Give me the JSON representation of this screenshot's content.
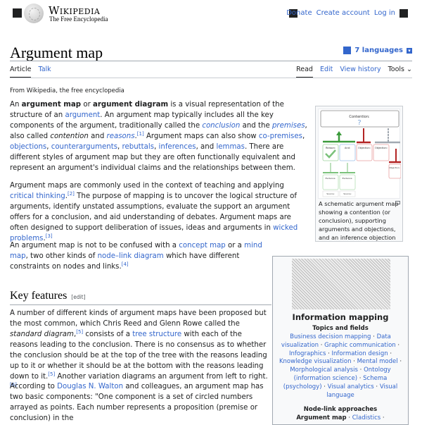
{
  "header": {
    "wordmark": "Wikipedia",
    "tagline": "The Free Encyclopedia",
    "links": [
      "Donate",
      "Create account",
      "Log in"
    ]
  },
  "page": {
    "title": "Argument map",
    "languages_label": "7 languages",
    "tabs_left": [
      "Article",
      "Talk"
    ],
    "tabs_right": [
      "Read",
      "Edit",
      "View history",
      "Tools"
    ],
    "from": "From Wikipedia, the free encyclopedia"
  },
  "intro": {
    "p1": [
      {
        "t": "An "
      },
      {
        "t": "argument map",
        "b": true
      },
      {
        "t": " or "
      },
      {
        "t": "argument diagram",
        "b": true
      },
      {
        "t": " is a visual representation of the structure of an "
      },
      {
        "t": "argument",
        "a": true
      },
      {
        "t": ". An argument map typically includes all the key components of the argument, traditionally called the "
      },
      {
        "t": "conclusion",
        "a": true,
        "i": true
      },
      {
        "t": " and the "
      },
      {
        "t": "premises",
        "a": true,
        "i": true
      },
      {
        "t": ", also called "
      },
      {
        "t": "contention",
        "i": true
      },
      {
        "t": " and "
      },
      {
        "t": "reasons",
        "a": true,
        "i": true
      },
      {
        "t": "."
      },
      {
        "t": "[1]",
        "sup": true
      },
      {
        "t": " Argument maps can also show "
      },
      {
        "t": "co-premises",
        "a": true
      },
      {
        "t": ", "
      },
      {
        "t": "objections",
        "a": true
      },
      {
        "t": ", "
      },
      {
        "t": "counterarguments",
        "a": true
      },
      {
        "t": ", "
      },
      {
        "t": "rebuttals",
        "a": true
      },
      {
        "t": ", "
      },
      {
        "t": "inferences",
        "a": true
      },
      {
        "t": ", and "
      },
      {
        "t": "lemmas",
        "a": true
      },
      {
        "t": ". There are different styles of argument map but they are often functionally equivalent and represent an argument's individual claims and the relationships between them."
      }
    ],
    "p2": [
      {
        "t": "Argument maps are commonly used in the context of teaching and applying "
      },
      {
        "t": "critical thinking",
        "a": true
      },
      {
        "t": "."
      },
      {
        "t": "[2]",
        "sup": true
      },
      {
        "t": " The purpose of mapping is to uncover the logical structure of arguments, identify unstated assumptions, evaluate the support an argument offers for a conclusion, and aid understanding of debates. Argument maps are often designed to support deliberation of issues, ideas and arguments in "
      },
      {
        "t": "wicked problems",
        "a": true
      },
      {
        "t": "."
      },
      {
        "t": "[3]",
        "sup": true
      }
    ],
    "p3": [
      {
        "t": "An argument map is not to be confused with a "
      },
      {
        "t": "concept map",
        "a": true
      },
      {
        "t": " or a "
      },
      {
        "t": "mind map",
        "a": true
      },
      {
        "t": ", two other kinds of "
      },
      {
        "t": "node–link diagram",
        "a": true
      },
      {
        "t": " which have different constraints on nodes and links."
      },
      {
        "t": "[4]",
        "sup": true
      }
    ]
  },
  "figure": {
    "caption": "A schematic argument map showing a contention (or conclusion), supporting arguments and objections, and an inference objection",
    "labels": {
      "contention": "Contention:",
      "reason": "Reason:",
      "and": "And:",
      "objection": "Objection:",
      "evidence": "Evidence:",
      "source": "Source:"
    }
  },
  "section": {
    "heading": "Key features",
    "edit": "[edit]",
    "p1": [
      {
        "t": "A number of different kinds of argument maps have been proposed but the most common, which Chris Reed and Glenn Rowe called the "
      },
      {
        "t": "standard diagram",
        "i": true
      },
      {
        "t": ","
      },
      {
        "t": "[5]",
        "sup": true
      },
      {
        "t": " consists of a "
      },
      {
        "t": "tree structure",
        "a": true
      },
      {
        "t": " with each of the reasons leading to the conclusion. There is no consensus as to whether the conclusion should be at the top of the tree with the reasons leading up to it or whether it should be at the bottom with the reasons leading down to it."
      },
      {
        "t": "[5]",
        "sup": true
      },
      {
        "t": " Another variation diagrams an argument from left to right."
      },
      {
        "t": "[6]",
        "sup": true
      }
    ],
    "p2": [
      {
        "t": "According to "
      },
      {
        "t": "Douglas N. Walton",
        "a": true
      },
      {
        "t": " and colleagues, an argument map has two basic components: \"One component is a set of circled numbers arrayed as points. Each number represents a proposition (premise or conclusion) in the"
      }
    ]
  },
  "infobox": {
    "title": "Information mapping",
    "topics_heading": "Topics and fields",
    "topics": [
      "Business decision mapping",
      "Data visualization",
      "Graphic communication",
      "Infographics",
      "Information design",
      "Knowledge visualization",
      "Mental model",
      "Morphological analysis",
      "Ontology (information science)",
      "Schema (psychology)",
      "Visual analytics",
      "Visual language"
    ],
    "nodelink_heading": "Node-link approaches",
    "nodelink": [
      {
        "t": "Argument map",
        "current": true
      },
      {
        "t": "Cladistics"
      }
    ]
  },
  "colors": {
    "link": "#3366cc",
    "text": "#202122",
    "support_green": "#3a9a3a",
    "objection_red": "#b32424",
    "inference_gray": "#a2a9b1"
  }
}
